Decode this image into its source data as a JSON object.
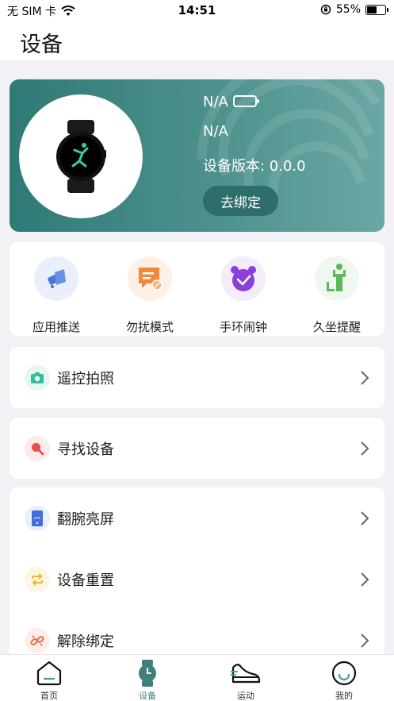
{
  "status_bar": {
    "carrier": "无 SIM 卡",
    "time": "14:51",
    "battery_percent": "55%",
    "battery_level": 0.55
  },
  "header": {
    "title": "设备"
  },
  "device": {
    "name": "N/A",
    "status": "N/A",
    "version": "设备版本: 0.0.0",
    "unbind_label": "去绑定",
    "card_colors": [
      "#2f7a76",
      "#6ba7a4"
    ]
  },
  "quick_functions": [
    {
      "label": "应用推送",
      "icon": "app-push-icon",
      "color": "#4a75d9"
    },
    {
      "label": "勿扰模式",
      "icon": "do-not-disturb-icon",
      "color": "#f08a3a"
    },
    {
      "label": "手环闹钟",
      "icon": "alarm-clock-icon",
      "color": "#8a3fd9"
    },
    {
      "label": "久坐提醒",
      "icon": "sedentary-reminder-icon",
      "color": "#5cb85c"
    }
  ],
  "settings": {
    "remote_camera": {
      "label": "遥控拍照",
      "icon": "camera-icon",
      "color": "#2fbf9f"
    },
    "find_device": {
      "label": "寻找设备",
      "icon": "search-icon",
      "color": "#e84b4b"
    },
    "wrist_wake": {
      "label": "翻腕亮屏",
      "icon": "phone-app-icon",
      "color": "#3f6fd9"
    },
    "reset_device": {
      "label": "设备重置",
      "icon": "refresh-icon",
      "color": "#f2b823"
    },
    "unbind_device": {
      "label": "解除绑定",
      "icon": "unlink-icon",
      "color": "#ef6a4a"
    }
  },
  "bottom_nav": [
    {
      "label": "首页",
      "icon": "home-icon"
    },
    {
      "label": "设备",
      "icon": "watch-icon",
      "active": true
    },
    {
      "label": "运动",
      "icon": "sneaker-icon"
    },
    {
      "label": "我的",
      "icon": "profile-icon"
    }
  ],
  "accent_color": "#3f7e7a"
}
